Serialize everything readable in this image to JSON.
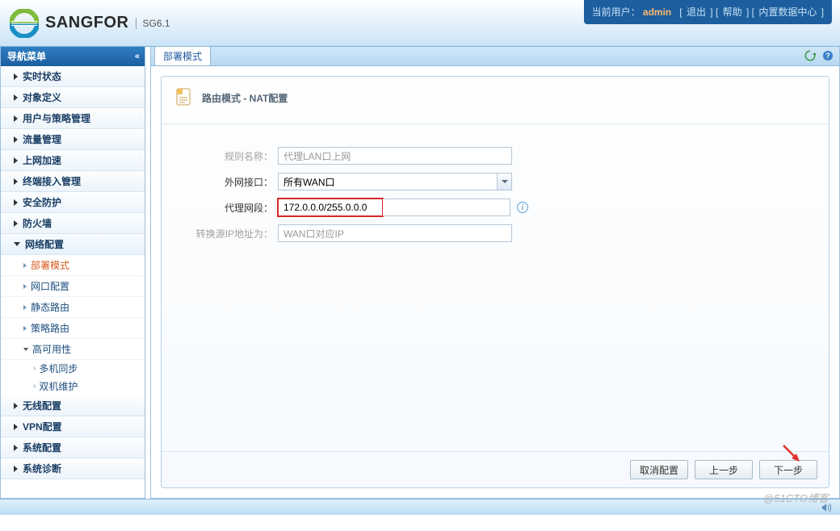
{
  "header": {
    "brand": "SANGFOR",
    "version": "SG6.1",
    "current_user_label": "当前用户：",
    "username": "admin",
    "logout": "退出",
    "help": "帮助",
    "datacenter": "内置数据中心"
  },
  "sidebar": {
    "title": "导航菜单",
    "items": [
      {
        "label": "实时状态"
      },
      {
        "label": "对象定义"
      },
      {
        "label": "用户与策略管理"
      },
      {
        "label": "流量管理"
      },
      {
        "label": "上网加速"
      },
      {
        "label": "终端接入管理"
      },
      {
        "label": "安全防护"
      },
      {
        "label": "防火墙"
      }
    ],
    "netcfg": {
      "label": "网络配置",
      "children": [
        {
          "label": "部署模式",
          "active": true
        },
        {
          "label": "网口配置"
        },
        {
          "label": "静态路由"
        },
        {
          "label": "策略路由"
        }
      ],
      "ha": {
        "label": "高可用性",
        "children": [
          {
            "label": "多机同步"
          },
          {
            "label": "双机维护"
          }
        ]
      }
    },
    "items_after": [
      {
        "label": "无线配置"
      },
      {
        "label": "VPN配置"
      },
      {
        "label": "系统配置"
      },
      {
        "label": "系统诊断"
      }
    ]
  },
  "tab": {
    "label": "部署模式"
  },
  "panel": {
    "title": "路由模式 - NAT配置",
    "fields": {
      "rule_name": {
        "label": "规则名称：",
        "value": "代理LAN口上网"
      },
      "wan_if": {
        "label": "外网接口：",
        "value": "所有WAN口"
      },
      "proxy_net": {
        "label": "代理网段：",
        "value": "172.0.0.0/255.0.0.0"
      },
      "trans_src": {
        "label": "转换源IP地址为：",
        "value": "WAN口对应IP"
      }
    },
    "buttons": {
      "cancel": "取消配置",
      "prev": "上一步",
      "next": "下一步"
    }
  },
  "watermark": "@51CTO博客"
}
